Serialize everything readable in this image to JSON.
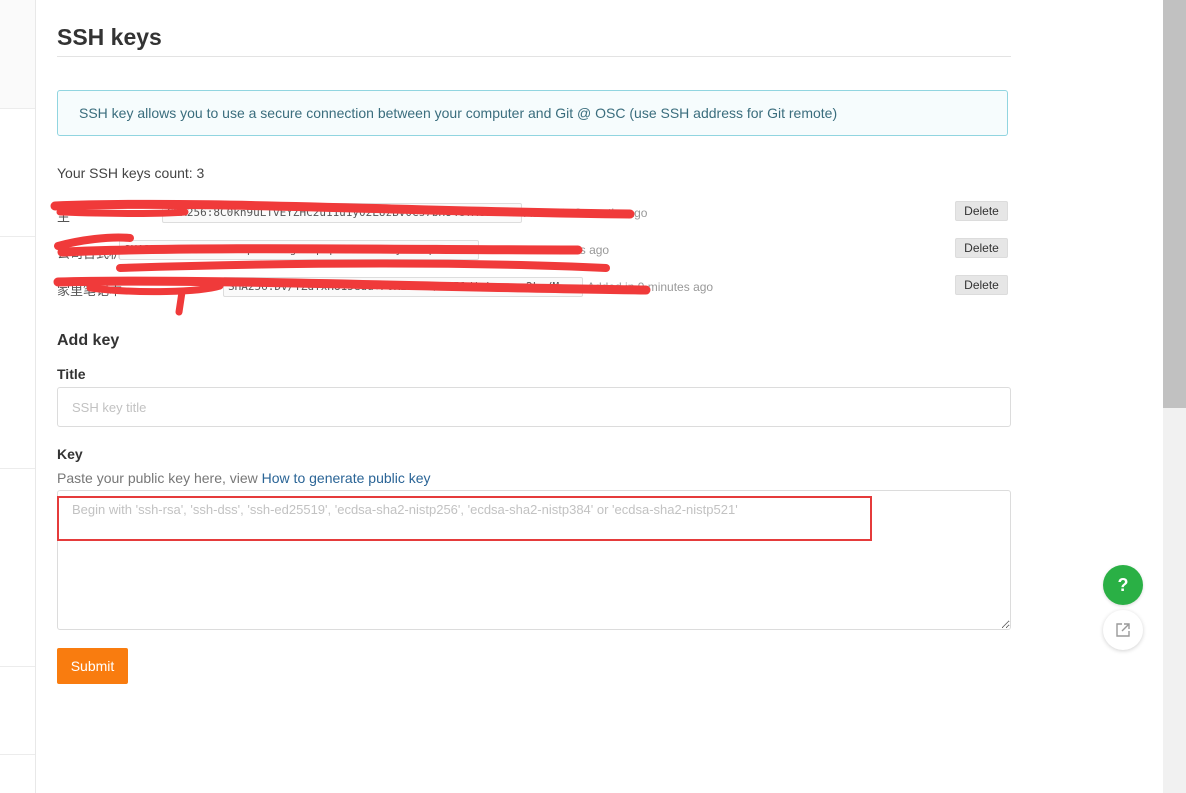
{
  "page": {
    "title": "SSH keys"
  },
  "info_message": "SSH key allows you to use a secure connection between your computer and Git @ OSC (use SSH address for Git remote)",
  "keys_count_text": "Your SSH keys count: 3",
  "keys": [
    {
      "name": "主",
      "fingerprint": "SHA256:8C0kn9uLTvEYZHC2u11u1y02LUzBv0Cs7bHU4GTXcoA",
      "added": "Added in 8 months ago"
    },
    {
      "name": "公司台式机",
      "fingerprint": "SHA256:MSZbWJ6NLB5q8Pc8zbgP9KpCpKwMRZaRn4y7C5Pp",
      "added": "Added in 8 minutes ago"
    },
    {
      "name": "家里笔记本",
      "fingerprint": "SHA256:Dv/YZdTxH815edd+P0KLEUE1/6L51dimhvunxe2kg/M",
      "added": "Added in 9 minutes ago"
    }
  ],
  "delete_label": "Delete",
  "form": {
    "heading": "Add key",
    "title_label": "Title",
    "title_placeholder": "SSH key title",
    "key_label": "Key",
    "key_hint": "Paste your public key here, view",
    "key_hint_link": "How to generate public key",
    "key_placeholder": "Begin with 'ssh-rsa', 'ssh-dss', 'ssh-ed25519', 'ecdsa-sha2-nistp256', 'ecdsa-sha2-nistp384' or 'ecdsa-sha2-nistp521'",
    "submit_label": "Submit"
  },
  "help_symbol": "?",
  "colors": {
    "accent": "#f97c0f",
    "help_green": "#2ab045",
    "info_border": "#91d5e0",
    "annotation_red": "#e53b3b"
  }
}
